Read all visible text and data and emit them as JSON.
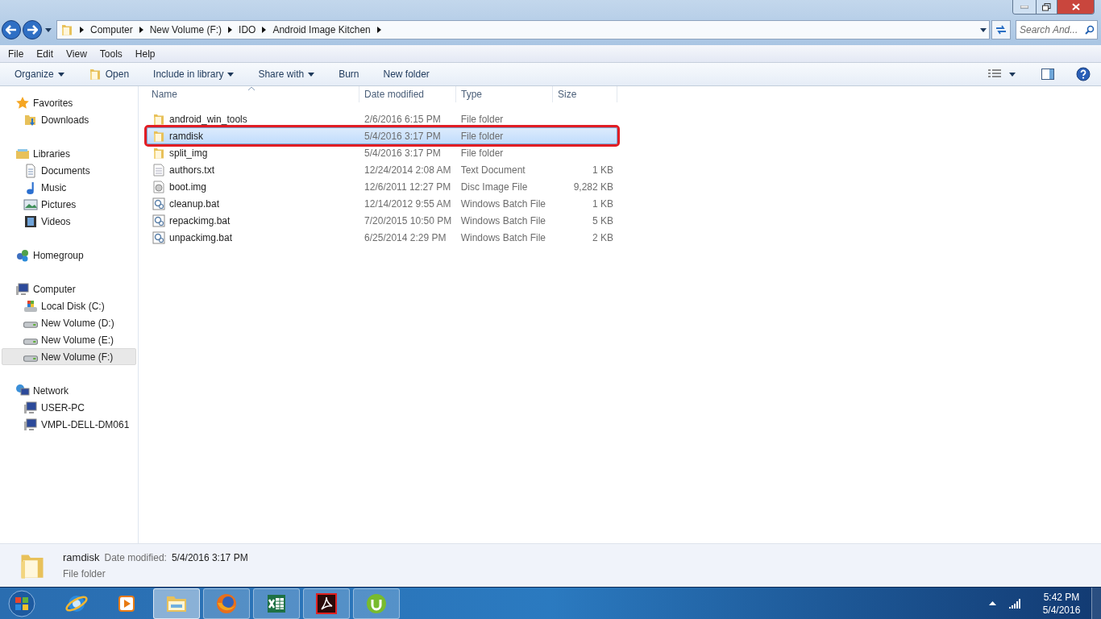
{
  "address_bar": {
    "breadcrumbs": [
      "Computer",
      "New Volume (F:)",
      "IDO",
      "Android Image Kitchen"
    ]
  },
  "search": {
    "placeholder": "Search And..."
  },
  "menu_bar": [
    "File",
    "Edit",
    "View",
    "Tools",
    "Help"
  ],
  "command_bar": [
    {
      "label": "Organize",
      "dropdown": true,
      "kind": "plain"
    },
    {
      "label": "Open",
      "dropdown": false,
      "kind": "open"
    },
    {
      "label": "Include in library",
      "dropdown": true,
      "kind": "plain"
    },
    {
      "label": "Share with",
      "dropdown": true,
      "kind": "plain"
    },
    {
      "label": "Burn",
      "dropdown": false,
      "kind": "plain"
    },
    {
      "label": "New folder",
      "dropdown": false,
      "kind": "plain"
    }
  ],
  "sidebar": {
    "groups": [
      {
        "label": "Favorites",
        "kind": "star",
        "children": [
          {
            "label": "Downloads",
            "kind": "downloads",
            "selected": false
          }
        ]
      },
      {
        "label": "Libraries",
        "kind": "library",
        "children": [
          {
            "label": "Documents",
            "kind": "document",
            "selected": false
          },
          {
            "label": "Music",
            "kind": "music",
            "selected": false
          },
          {
            "label": "Pictures",
            "kind": "pictures",
            "selected": false
          },
          {
            "label": "Videos",
            "kind": "videos",
            "selected": false
          }
        ]
      },
      {
        "label": "Homegroup",
        "kind": "homegroup"
      },
      {
        "label": "Computer",
        "kind": "computer",
        "children": [
          {
            "label": "Local Disk (C:)",
            "kind": "systemdisk",
            "selected": false
          },
          {
            "label": "New Volume (D:)",
            "kind": "drive",
            "selected": false
          },
          {
            "label": "New Volume (E:)",
            "kind": "drive",
            "selected": false
          },
          {
            "label": "New Volume (F:)",
            "kind": "drive",
            "selected": true
          }
        ]
      },
      {
        "label": "Network",
        "kind": "network",
        "children": [
          {
            "label": "USER-PC",
            "kind": "computer",
            "selected": false
          },
          {
            "label": "VMPL-DELL-DM061",
            "kind": "computer",
            "selected": false
          }
        ]
      }
    ]
  },
  "file_list": {
    "columns": [
      "Name",
      "Date modified",
      "Type",
      "Size"
    ],
    "rows": [
      {
        "name": "android_win_tools",
        "date": "2/6/2016 6:15 PM",
        "type": "File folder",
        "kind": "folder",
        "selected": false,
        "outlined": false
      },
      {
        "name": "ramdisk",
        "date": "5/4/2016 3:17 PM",
        "type": "File folder",
        "kind": "folder",
        "selected": true,
        "outlined": true
      },
      {
        "name": "split_img",
        "date": "5/4/2016 3:17 PM",
        "type": "File folder",
        "kind": "folder",
        "selected": false,
        "outlined": false
      },
      {
        "name": "authors.txt",
        "date": "12/24/2014 2:08 AM",
        "type": "Text Document",
        "size": "1 KB",
        "kind": "text",
        "selected": false,
        "outlined": false
      },
      {
        "name": "boot.img",
        "date": "12/6/2011 12:27 PM",
        "type": "Disc Image File",
        "size": "9,282 KB",
        "kind": "disc",
        "selected": false,
        "outlined": false
      },
      {
        "name": "cleanup.bat",
        "date": "12/14/2012 9:55 AM",
        "type": "Windows Batch File",
        "size": "1 KB",
        "kind": "batch",
        "selected": false,
        "outlined": false
      },
      {
        "name": "repackimg.bat",
        "date": "7/20/2015 10:50 PM",
        "type": "Windows Batch File",
        "size": "5 KB",
        "kind": "batch",
        "selected": false,
        "outlined": false
      },
      {
        "name": "unpackimg.bat",
        "date": "6/25/2014 2:29 PM",
        "type": "Windows Batch File",
        "size": "2 KB",
        "kind": "batch",
        "selected": false,
        "outlined": false
      }
    ]
  },
  "details_pane": {
    "name": "ramdisk",
    "date_label": "Date modified:",
    "date": "5/4/2016 3:17 PM",
    "type": "File folder"
  },
  "taskbar": {
    "apps": [
      {
        "kind": "ie",
        "active": false
      },
      {
        "kind": "media",
        "active": false
      },
      {
        "kind": "explorer",
        "active": true
      },
      {
        "kind": "firefox",
        "active": true
      },
      {
        "kind": "excel",
        "active": true
      },
      {
        "kind": "acrobat",
        "active": true
      },
      {
        "kind": "utorrent",
        "active": true
      }
    ],
    "time": "5:42 PM",
    "date": "5/4/2016"
  }
}
